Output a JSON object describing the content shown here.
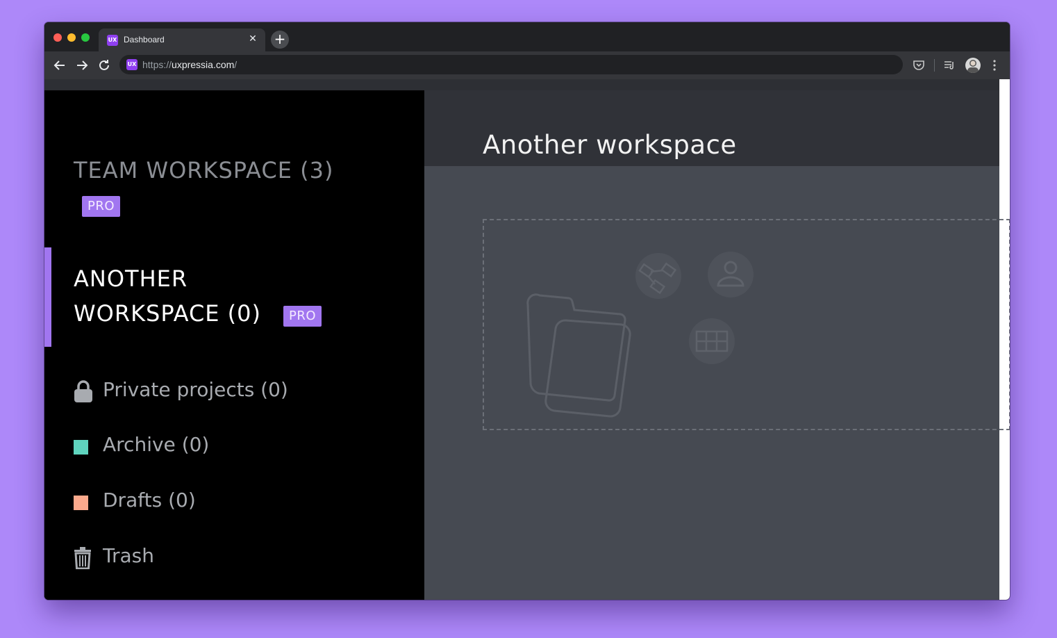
{
  "browser": {
    "tab_title": "Dashboard",
    "favicon_text": "UX",
    "url_scheme": "https://",
    "url_domain": "uxpressia.com",
    "url_path": "/"
  },
  "sidebar": {
    "team_workspace": "TEAM WORKSPACE (3)",
    "team_badge": "PRO",
    "another_workspace_line1": "ANOTHER",
    "another_workspace_line2": "WORKSPACE (0)",
    "another_badge": "PRO",
    "items": [
      {
        "label": "Private projects (0)",
        "icon": "lock-icon"
      },
      {
        "label": "Archive",
        "count": "(0)",
        "icon": "archive-color-square",
        "color": "#5fd4be"
      },
      {
        "label": "Drafts",
        "count": "(0)",
        "icon": "drafts-color-square",
        "color": "#fba98c"
      },
      {
        "label": "Trash",
        "icon": "trash-icon"
      }
    ]
  },
  "main": {
    "title": "Another workspace"
  },
  "colors": {
    "accent": "#a176f0",
    "background": "#ad88f9",
    "sidebar": "#000000",
    "main": "#464a52",
    "header": "#303238"
  }
}
